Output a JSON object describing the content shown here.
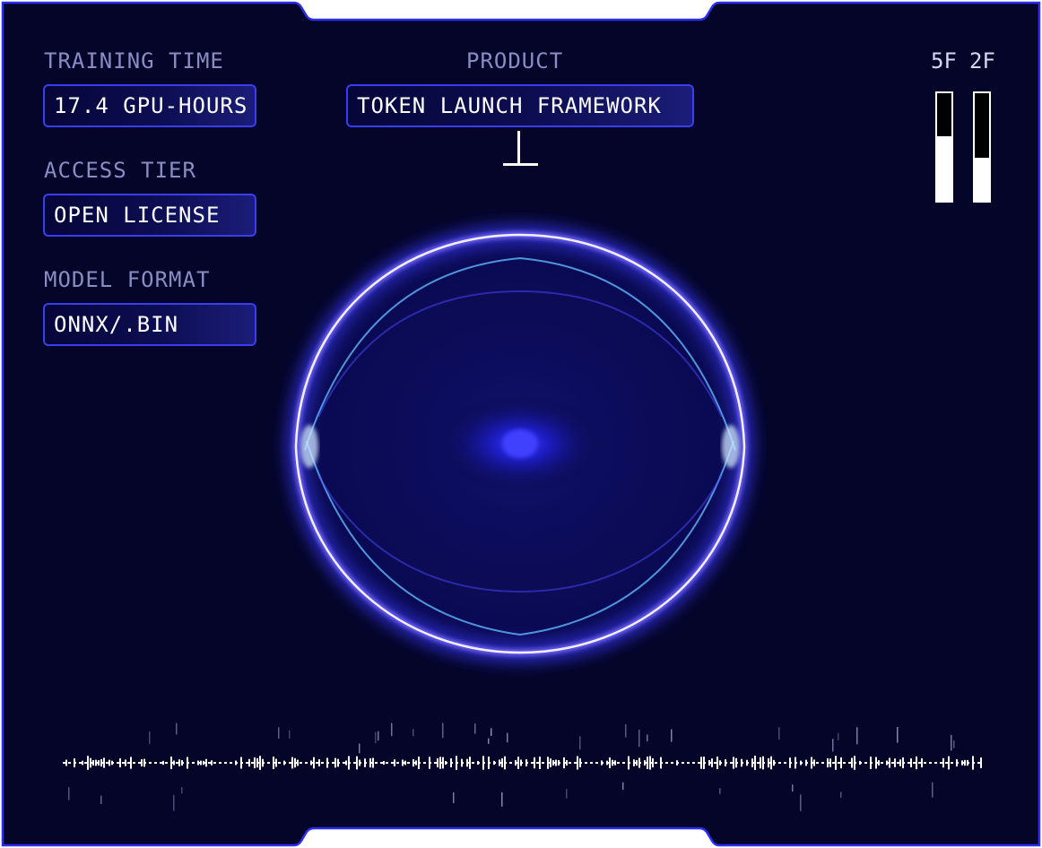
{
  "colors": {
    "background": "#05052a",
    "frame_border": "#2b2df0",
    "accent": "#3b3df0",
    "label": "#8a8cc4",
    "value": "#ffffff"
  },
  "fields": [
    {
      "label": "TRAINING TIME",
      "value": "17.4 GPU-HOURS"
    },
    {
      "label": "ACCESS TIER",
      "value": "OPEN LICENSE"
    },
    {
      "label": "MODEL FORMAT",
      "value": "ONNX∕.BIN"
    }
  ],
  "product": {
    "label": "PRODUCT",
    "value": "TOKEN LAUNCH FRAMEWORK"
  },
  "meters": [
    {
      "label": "5F",
      "level": 0.6
    },
    {
      "label": "2F",
      "level": 0.4
    }
  ],
  "icons": {
    "orb": "glowing-ring-orb",
    "waveform": "audio-waveform"
  }
}
